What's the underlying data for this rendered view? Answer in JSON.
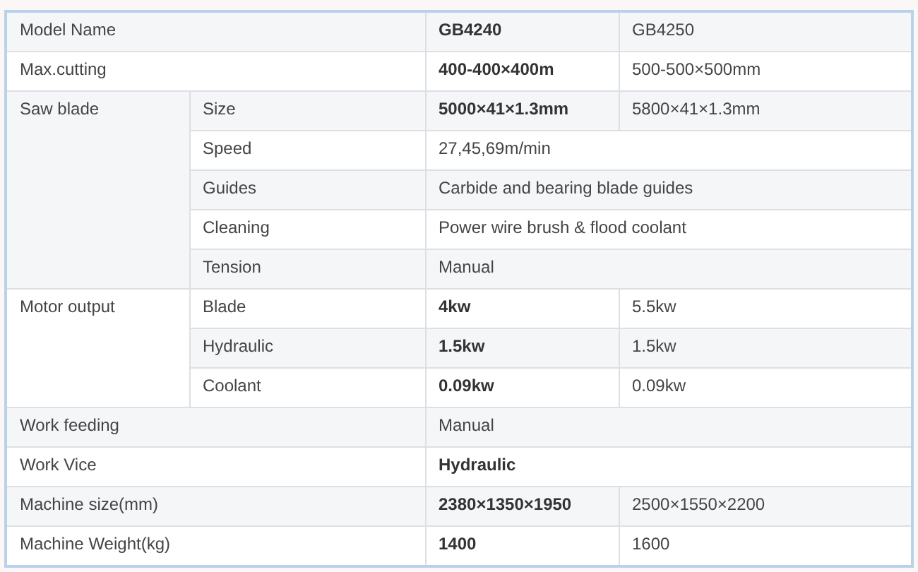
{
  "table": {
    "rows": [
      {
        "label": "Model Name",
        "values": [
          {
            "text": "GB4240",
            "bold": true
          },
          {
            "text": "GB4250",
            "bold": false
          }
        ]
      },
      {
        "label": "Max.cutting",
        "values": [
          {
            "text": "400-400×400m",
            "bold": true
          },
          {
            "text": "500-500×500mm",
            "bold": false
          }
        ]
      },
      {
        "label": "Saw blade",
        "children": [
          {
            "label": "Size",
            "values": [
              {
                "text": "5000×41×1.3mm",
                "bold": true
              },
              {
                "text": "5800×41×1.3mm",
                "bold": false
              }
            ]
          },
          {
            "label": "Speed",
            "values": [
              {
                "text": "27,45,69m/min",
                "bold": false
              }
            ]
          },
          {
            "label": "Guides",
            "values": [
              {
                "text": "Carbide and bearing blade guides",
                "bold": false
              }
            ]
          },
          {
            "label": "Cleaning",
            "values": [
              {
                "text": "Power wire brush & flood coolant",
                "bold": false
              }
            ]
          },
          {
            "label": "Tension",
            "values": [
              {
                "text": "Manual",
                "bold": false
              }
            ]
          }
        ]
      },
      {
        "label": "Motor output",
        "children": [
          {
            "label": "Blade",
            "values": [
              {
                "text": "4kw",
                "bold": true
              },
              {
                "text": "5.5kw",
                "bold": false
              }
            ]
          },
          {
            "label": "Hydraulic",
            "values": [
              {
                "text": "1.5kw",
                "bold": true
              },
              {
                "text": "1.5kw",
                "bold": false
              }
            ]
          },
          {
            "label": "Coolant",
            "values": [
              {
                "text": "0.09kw",
                "bold": true
              },
              {
                "text": "0.09kw",
                "bold": false
              }
            ]
          }
        ]
      },
      {
        "label": "Work feeding",
        "values": [
          {
            "text": "Manual",
            "bold": false
          }
        ]
      },
      {
        "label": "Work Vice",
        "values": [
          {
            "text": "Hydraulic",
            "bold": true
          }
        ]
      },
      {
        "label": "Machine size(mm)",
        "values": [
          {
            "text": "2380×1350×1950",
            "bold": true
          },
          {
            "text": "2500×1550×2200",
            "bold": false
          }
        ]
      },
      {
        "label": "Machine Weight(kg)",
        "values": [
          {
            "text": "1400",
            "bold": true
          },
          {
            "text": "1600",
            "bold": false
          }
        ]
      }
    ]
  }
}
